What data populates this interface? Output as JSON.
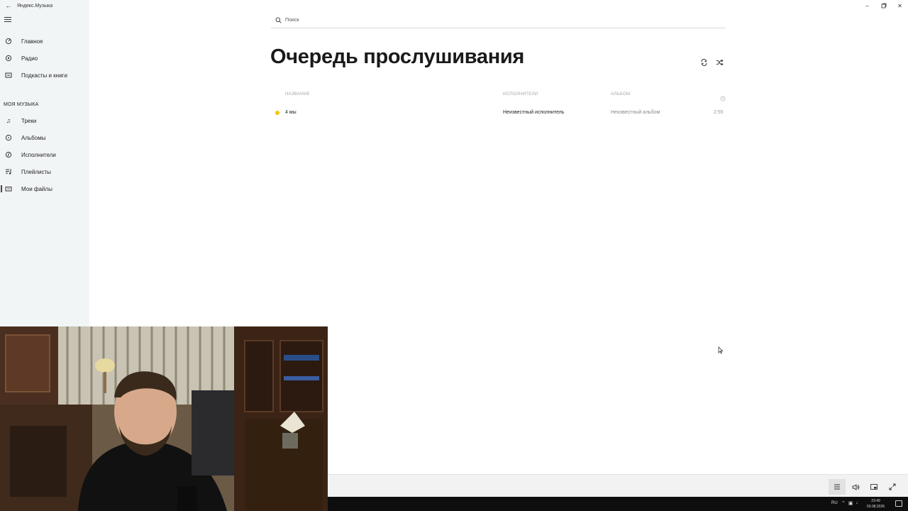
{
  "app": {
    "title": "Яндекс.Музыка"
  },
  "sidebar": {
    "main_items": [
      {
        "label": "Главное",
        "icon": "home-icon"
      },
      {
        "label": "Радио",
        "icon": "radio-icon"
      },
      {
        "label": "Подкасты и книги",
        "icon": "podcast-icon"
      }
    ],
    "section_title": "МОЯ МУЗЫКА",
    "my_music_items": [
      {
        "label": "Треки",
        "icon": "note-icon"
      },
      {
        "label": "Альбомы",
        "icon": "album-icon"
      },
      {
        "label": "Исполнители",
        "icon": "artist-icon"
      },
      {
        "label": "Плейлисты",
        "icon": "playlist-icon"
      },
      {
        "label": "Мои файлы",
        "icon": "folder-icon",
        "active": true
      }
    ]
  },
  "search": {
    "placeholder": "Поиск"
  },
  "main": {
    "title": "Очередь прослушивания",
    "columns": {
      "title": "НАЗВАНИЕ",
      "artists": "ИСПОЛНИТЕЛИ",
      "album": "АЛЬБОМ"
    },
    "tracks": [
      {
        "title": "4 мы",
        "artist": "Неизвестный исполнитель",
        "album": "Неизвестный альбом",
        "duration": "2:55"
      }
    ]
  },
  "taskbar": {
    "lang": "RU",
    "time": "23:49",
    "date": "03.08.2026"
  },
  "colors": {
    "sidebar_bg": "#f2f5f6",
    "now_playing_dot": "#f5c400",
    "taskbar_bg": "#0e0e0e"
  }
}
